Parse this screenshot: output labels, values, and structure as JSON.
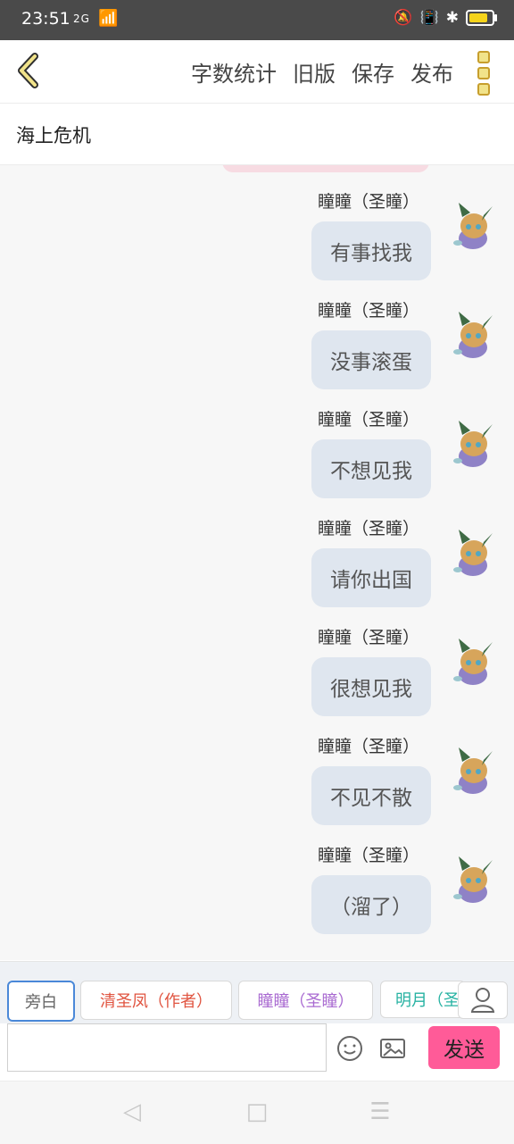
{
  "status": {
    "time": "23:51",
    "network": "2G",
    "icons": [
      "signal-icon",
      "wifi-icon",
      "mute-icon",
      "vibrate-icon",
      "bluetooth-icon",
      "battery-icon"
    ],
    "battery_level": 0.85,
    "battery_color": "#f5d31a"
  },
  "header": {
    "back_icon": "back-chevron-icon",
    "actions": [
      "字数统计",
      "旧版",
      "保存",
      "发布"
    ],
    "more_icon": "more-vertical-icon"
  },
  "story": {
    "title": "海上危机"
  },
  "messages": [
    {
      "sender": "瞳瞳（圣瞳）",
      "text": "有事找我"
    },
    {
      "sender": "瞳瞳（圣瞳）",
      "text": "没事滚蛋"
    },
    {
      "sender": "瞳瞳（圣瞳）",
      "text": "不想见我"
    },
    {
      "sender": "瞳瞳（圣瞳）",
      "text": "请你出国"
    },
    {
      "sender": "瞳瞳（圣瞳）",
      "text": "很想见我"
    },
    {
      "sender": "瞳瞳（圣瞳）",
      "text": "不见不散"
    },
    {
      "sender": "瞳瞳（圣瞳）",
      "text": "（溜了）"
    }
  ],
  "cast": {
    "chips": [
      "旁白",
      "清圣凤（作者）",
      "瞳瞳（圣瞳）",
      "明月（圣"
    ],
    "colors": {
      "narrator": "#666666",
      "author": "#e0533f",
      "tong": "#a96ad1",
      "mingyue": "#26b2a2"
    }
  },
  "composer": {
    "value": "",
    "placeholder": "",
    "send_label": "发送",
    "send_color": "#ff5b98"
  },
  "nav": {
    "icons": [
      "nav-back-icon",
      "nav-home-icon",
      "nav-menu-icon"
    ]
  }
}
